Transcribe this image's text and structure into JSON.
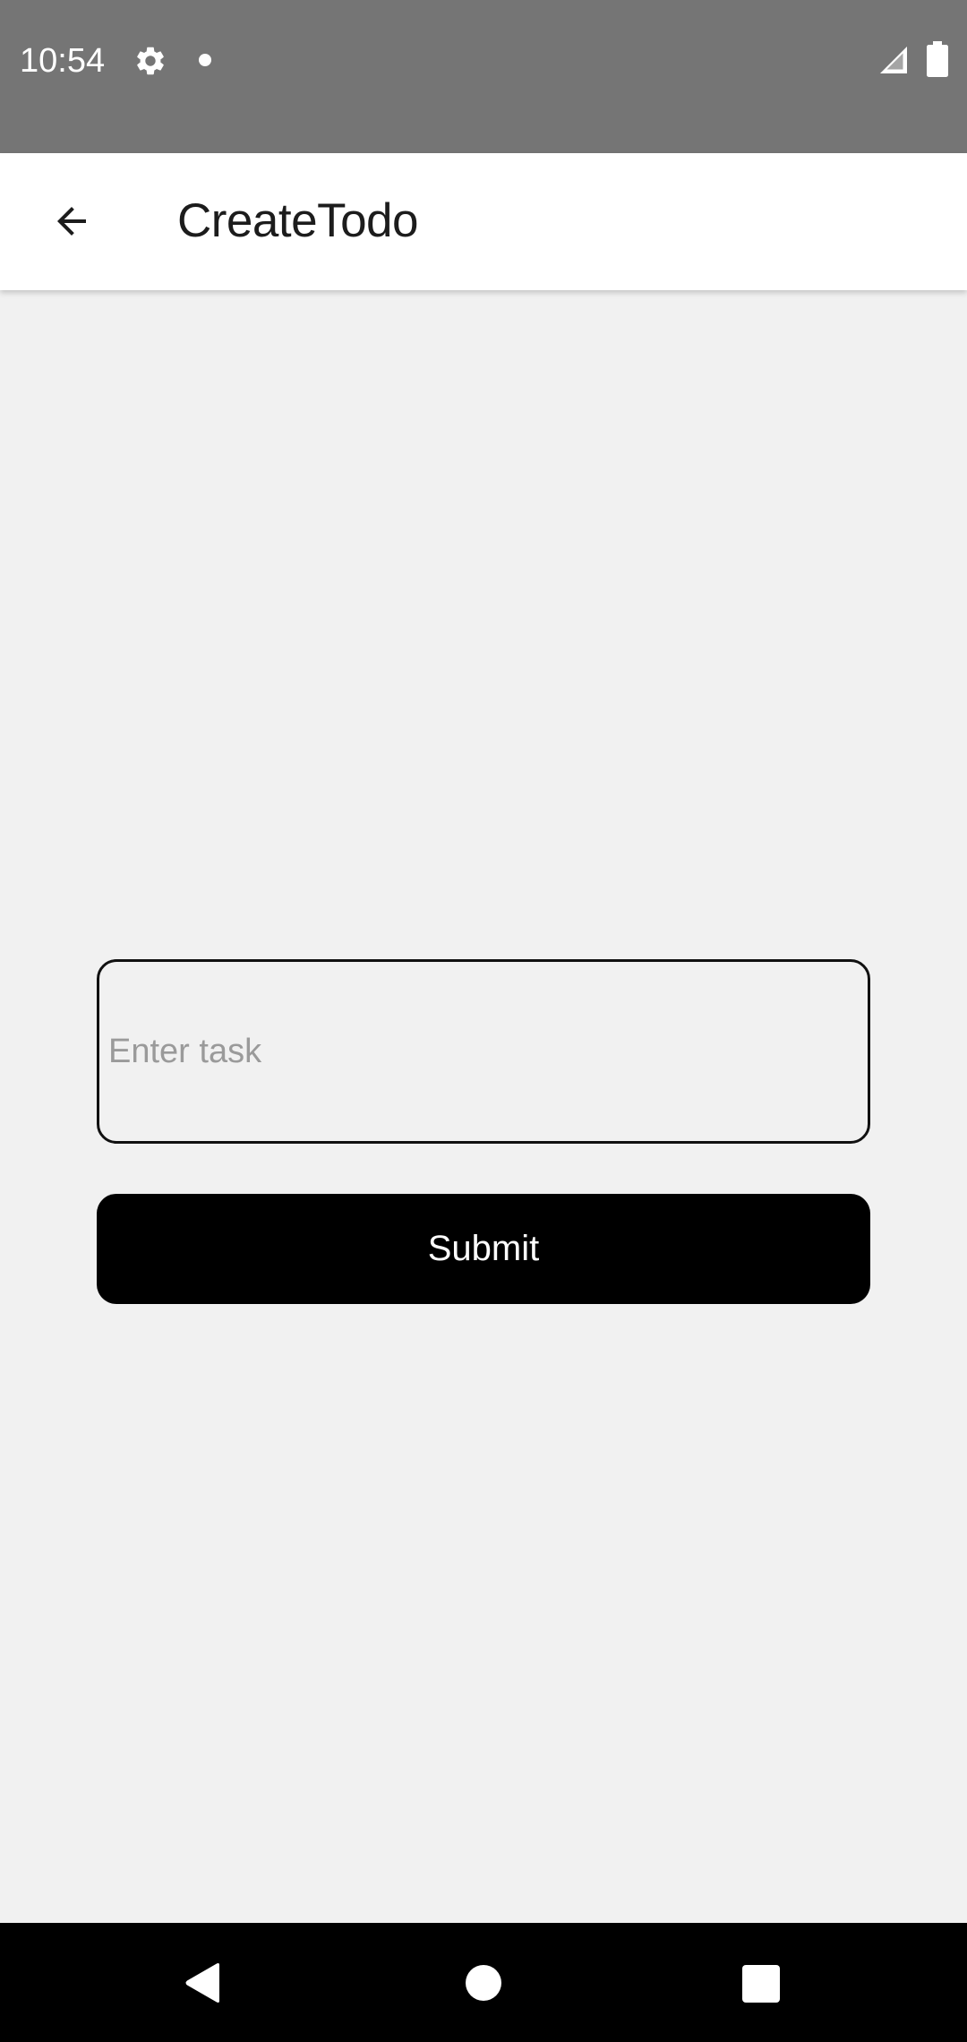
{
  "status_bar": {
    "time": "10:54",
    "icons": [
      "settings-gear-icon",
      "notification-dot-icon",
      "cell-signal-icon",
      "battery-icon"
    ]
  },
  "app_bar": {
    "title": "CreateTodo",
    "back_icon": "arrow-back-icon"
  },
  "form": {
    "task_input": {
      "value": "",
      "placeholder": "Enter task"
    },
    "submit_label": "Submit"
  },
  "nav_bar": {
    "icons": [
      "nav-back-icon",
      "nav-home-icon",
      "nav-recents-icon"
    ]
  },
  "colors": {
    "status_bar": "#757575",
    "app_bar": "#ffffff",
    "background": "#f1f1f1",
    "button": "#000000",
    "button_text": "#ffffff",
    "nav_bar": "#000000"
  }
}
